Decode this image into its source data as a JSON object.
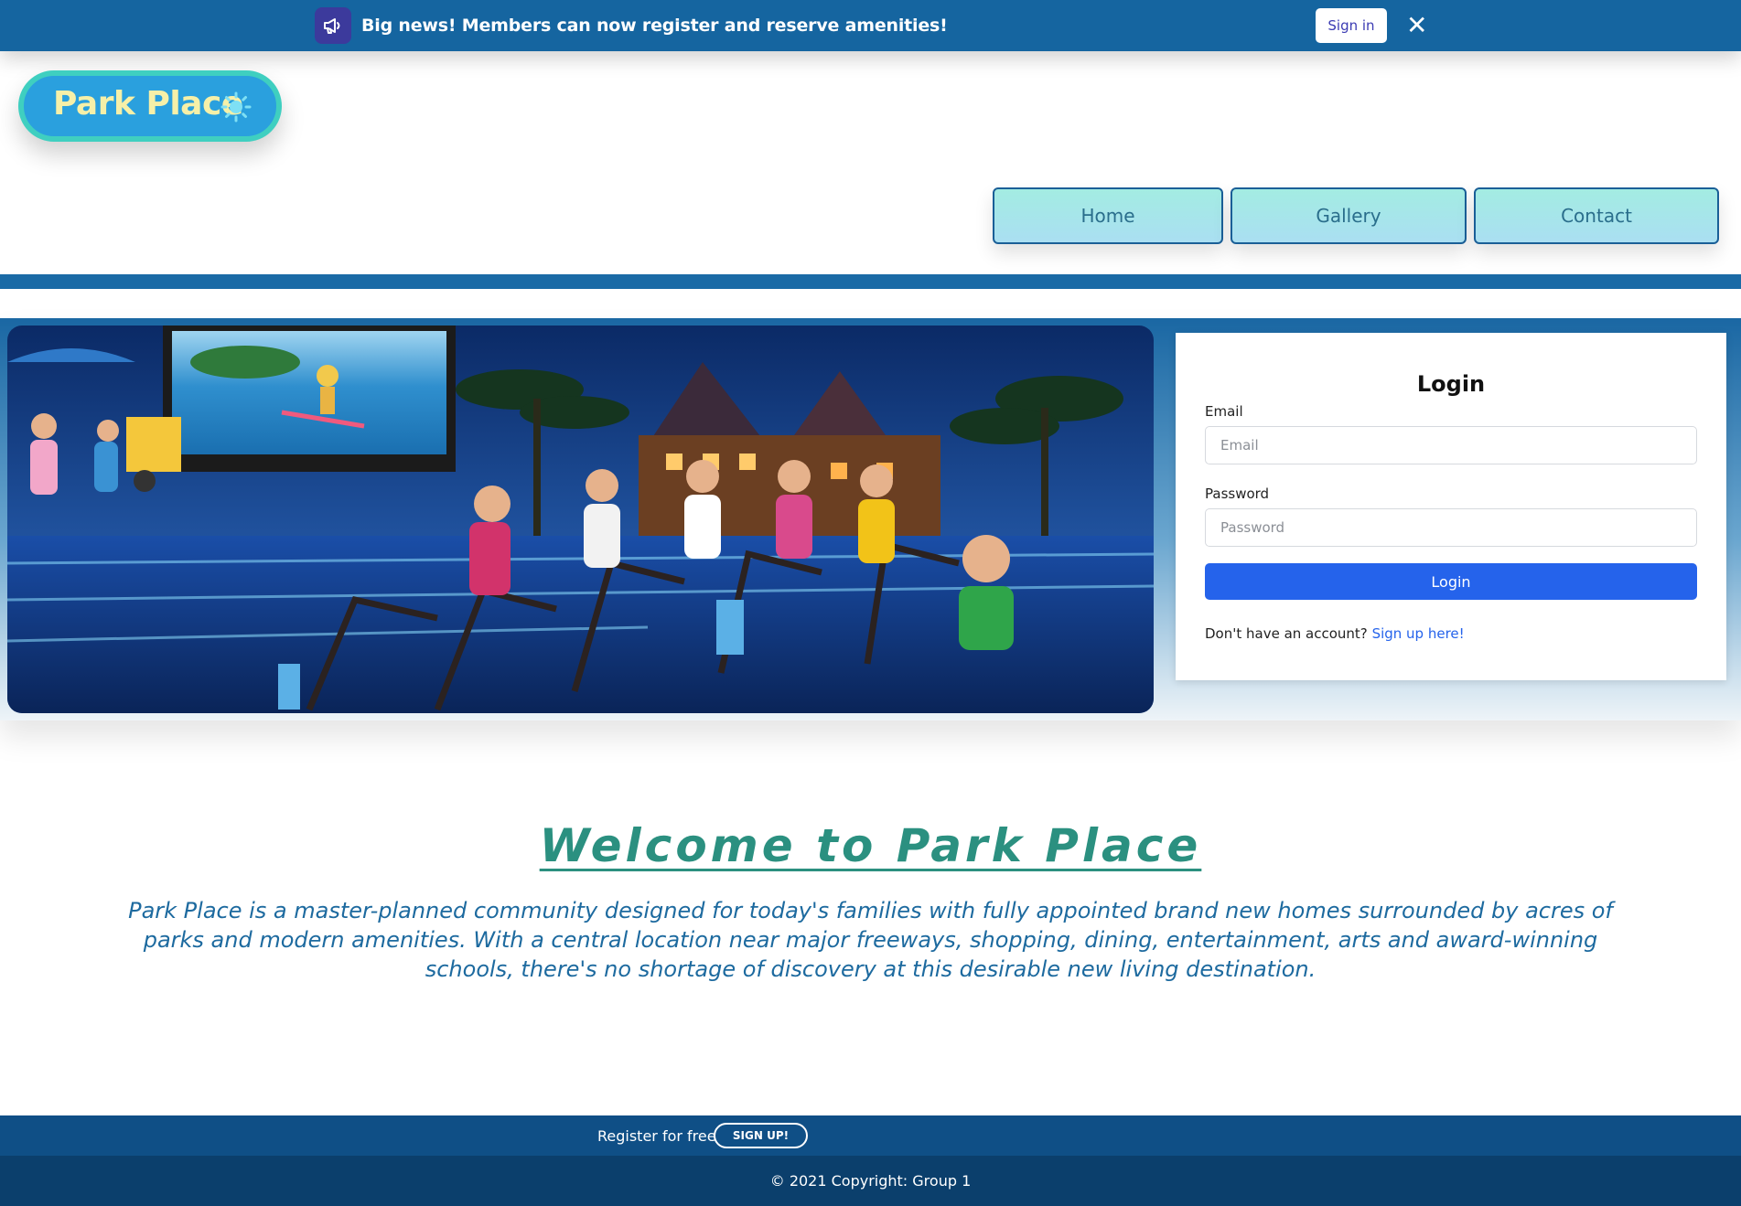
{
  "banner": {
    "icon": "megaphone-icon",
    "message": "Big news! Members can now register and reserve amenities!",
    "signin_label": "Sign in",
    "close_icon": "close-icon",
    "close_glyph": "✕"
  },
  "logo": {
    "text": "Park Place",
    "icon": "sun-icon"
  },
  "nav": {
    "items": [
      {
        "label": "Home"
      },
      {
        "label": "Gallery"
      },
      {
        "label": "Contact"
      }
    ]
  },
  "login": {
    "title": "Login",
    "email_label": "Email",
    "email_placeholder": "Email",
    "password_label": "Password",
    "password_placeholder": "Password",
    "submit_label": "Login",
    "signup_prompt": "Don't have an account?",
    "signup_link": "Sign up here!"
  },
  "main": {
    "heading": "Welcome to Park Place",
    "intro": "Park Place is a master-planned community designed for today's families with fully appointed brand new homes surrounded by acres of parks and modern amenities. With a central location near major freeways, shopping, dining, entertainment, arts and award-winning schools, there's no shortage of discovery at this desirable new living destination."
  },
  "footer": {
    "register_text": "Register for free",
    "signup_button": "SIGN UP!",
    "copyright": "© 2021 Copyright: Group 1"
  },
  "colors": {
    "banner": "#1565a0",
    "accent": "#2563eb",
    "heading": "#2b9080",
    "intro": "#1d6a9f",
    "footer_top": "#0f4f86",
    "footer_bottom": "#0b3f6c"
  }
}
